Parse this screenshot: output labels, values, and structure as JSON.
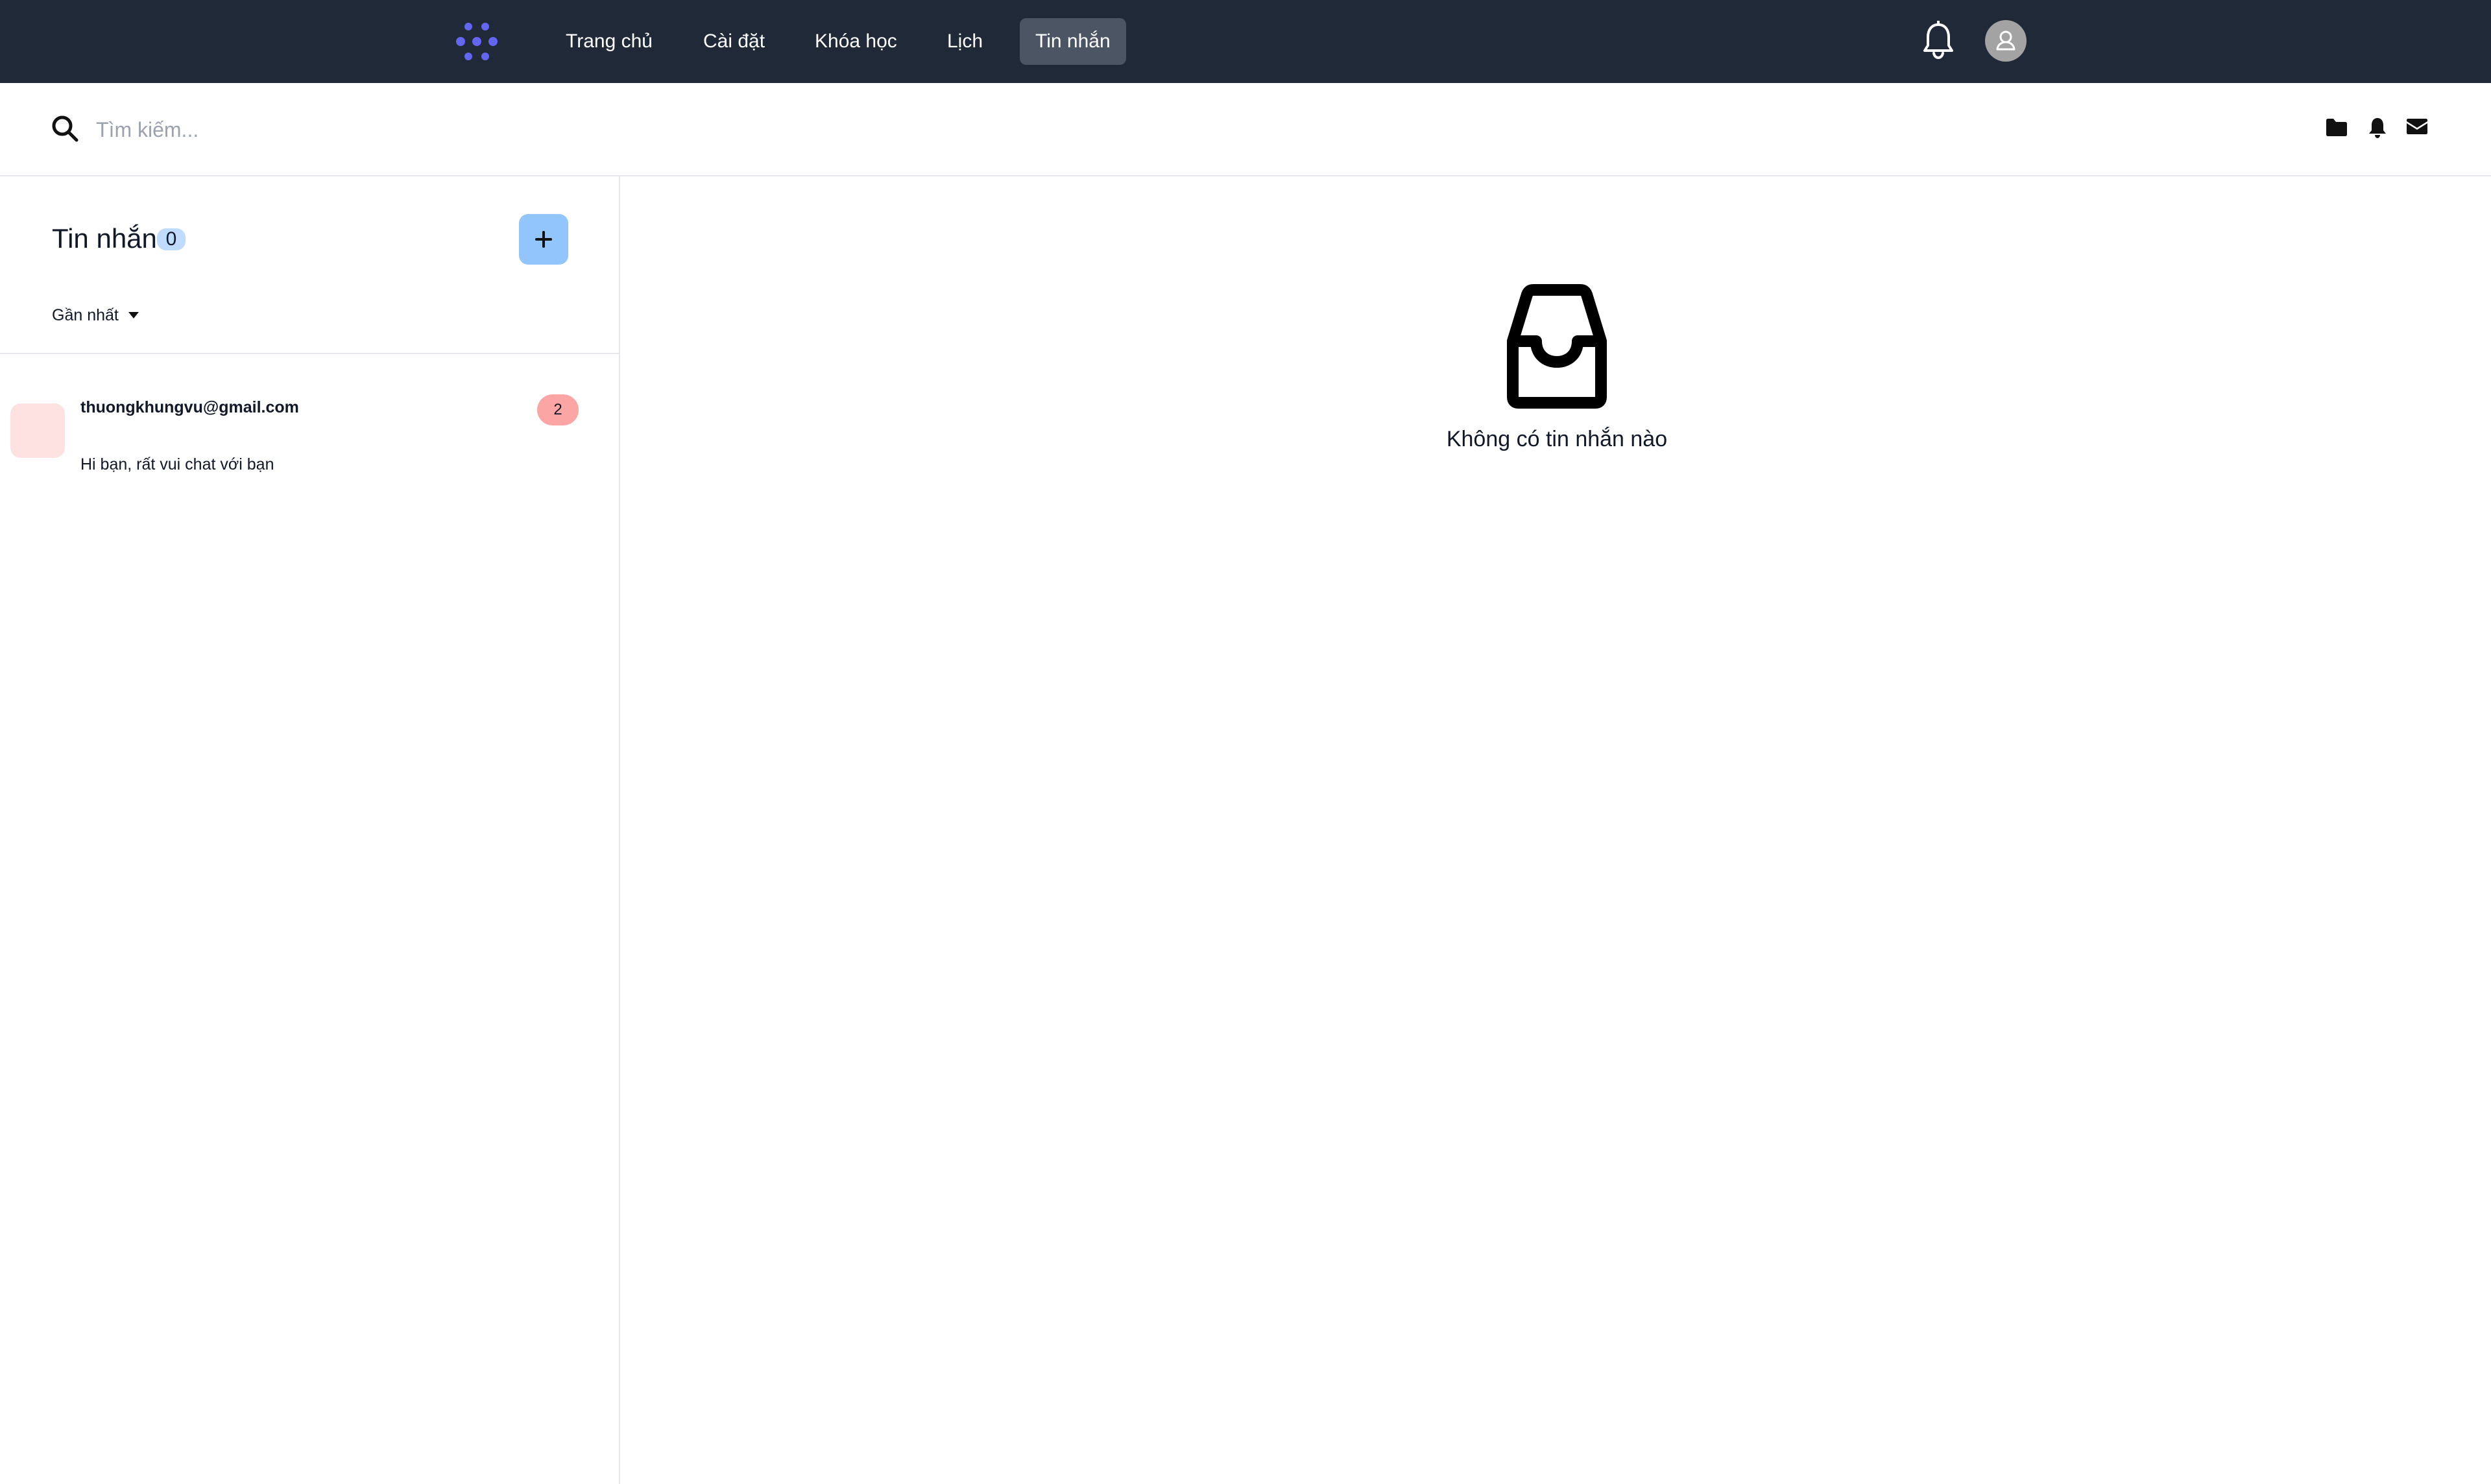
{
  "colors": {
    "topbar_bg": "#1f2937",
    "nav_active_bg": "#4b5563",
    "logo_accent": "#6366f1",
    "add_button_bg": "#93c5fd",
    "count_badge_bg": "#bfdbfe",
    "unread_badge_bg": "#fca5a5",
    "conv_avatar_bg": "#fee2e2"
  },
  "nav": {
    "items": [
      {
        "label": "Trang chủ"
      },
      {
        "label": "Cài đặt"
      },
      {
        "label": "Khóa học"
      },
      {
        "label": "Lịch"
      },
      {
        "label": "Tin nhắn",
        "active": true
      }
    ],
    "icons": [
      "logo-icon",
      "bell-icon",
      "user-avatar-icon"
    ]
  },
  "search": {
    "placeholder": "Tìm kiếm...",
    "value": "",
    "icons": [
      "search-icon",
      "folder-icon",
      "bell-icon",
      "envelope-icon"
    ]
  },
  "sidebar": {
    "title": "Tin nhắn",
    "count": "0",
    "sort_label": "Gần nhất",
    "conversations": [
      {
        "name": "thuongkhungvu@gmail.com",
        "preview": "Hi bạn, rất vui chat với bạn",
        "unread": "2"
      }
    ]
  },
  "main": {
    "empty_text": "Không có tin nhắn nào",
    "empty_icon": "inbox-icon"
  }
}
